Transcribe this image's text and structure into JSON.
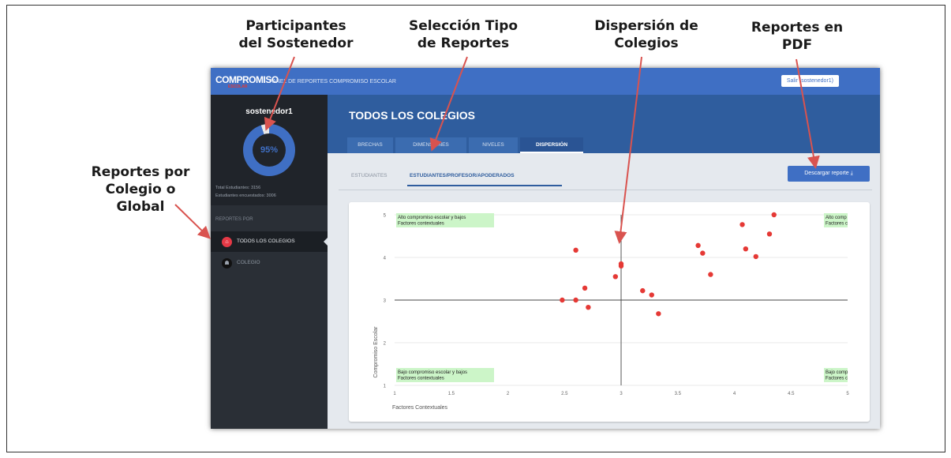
{
  "callouts": {
    "participantes": "Participantes\ndel Sostenedor",
    "seleccion": "Selección Tipo\nde Reportes",
    "dispersion": "Dispersión de\nColegios",
    "pdf": "Reportes en\nPDF",
    "global": "Reportes  por\nColegio o\nGlobal"
  },
  "header": {
    "brand": "COMPROMISO",
    "brand_sub": "ESCOLAR",
    "panel_title": "PANEL DE REPORTES COMPROMISO ESCOLAR",
    "logout_label": "Salir (sostenedor1)"
  },
  "sidebar": {
    "username": "sostenedor1",
    "percent": "95%",
    "progress": 0.95,
    "total_students": "Total Estudiantes: 3156",
    "surveyed_students": "Estudiantes encuestados: 3006",
    "section_label": "REPORTES POR",
    "items": [
      {
        "label": "TODOS LOS COLEGIOS",
        "icon": "home-icon",
        "active": true
      },
      {
        "label": "COLEGIO",
        "icon": "users-icon",
        "active": false
      }
    ]
  },
  "main": {
    "title": "TODOS LOS COLEGIOS",
    "tabs": [
      "BRECHAS",
      "DIMENSIONES",
      "NIVELES",
      "DISPERSIÓN"
    ],
    "active_tab": "DISPERSIÓN",
    "subtabs": [
      "ESTUDIANTES",
      "ESTUDIANTES/PROFESOR/APODERADOS"
    ],
    "active_subtab": "ESTUDIANTES/PROFESOR/APODERADOS",
    "download_label": "Descargar reporte"
  },
  "chart_data": {
    "type": "scatter",
    "xlabel": "Factores Contextuales",
    "ylabel": "Compromiso Escolar",
    "xlim": [
      1,
      5
    ],
    "ylim": [
      1,
      5
    ],
    "xticks": [
      "1",
      "1.5",
      "2",
      "2.5",
      "3",
      "3.5",
      "4",
      "4.5",
      "5"
    ],
    "yticks": [
      "1",
      "2",
      "3",
      "4",
      "5"
    ],
    "reference_lines": {
      "x": 3,
      "y": 3
    },
    "quadrant_labels": [
      {
        "position": "top-left",
        "line1": "Alto compromiso escolar y bajos",
        "line2": "Factores contextuales"
      },
      {
        "position": "top-right",
        "line1": "Alto comp",
        "line2": "Factores c"
      },
      {
        "position": "bottom-left",
        "line1": "Bajo compromiso escolar y bajos",
        "line2": "Factores contextuales"
      },
      {
        "position": "bottom-right",
        "line1": "Bajo comp",
        "line2": "Factores c"
      }
    ],
    "point_color": "#e53935",
    "points": [
      {
        "x": 2.6,
        "y": 4.17
      },
      {
        "x": 2.48,
        "y": 3.0
      },
      {
        "x": 2.6,
        "y": 3.0
      },
      {
        "x": 2.68,
        "y": 3.28
      },
      {
        "x": 2.71,
        "y": 2.83
      },
      {
        "x": 2.95,
        "y": 3.55
      },
      {
        "x": 3.0,
        "y": 3.85
      },
      {
        "x": 3.0,
        "y": 3.8
      },
      {
        "x": 3.19,
        "y": 3.22
      },
      {
        "x": 3.27,
        "y": 3.12
      },
      {
        "x": 3.33,
        "y": 2.68
      },
      {
        "x": 3.68,
        "y": 4.28
      },
      {
        "x": 3.72,
        "y": 4.1
      },
      {
        "x": 3.79,
        "y": 3.6
      },
      {
        "x": 4.07,
        "y": 4.77
      },
      {
        "x": 4.1,
        "y": 4.2
      },
      {
        "x": 4.19,
        "y": 4.02
      },
      {
        "x": 4.31,
        "y": 4.55
      },
      {
        "x": 4.35,
        "y": 5.0
      }
    ]
  }
}
